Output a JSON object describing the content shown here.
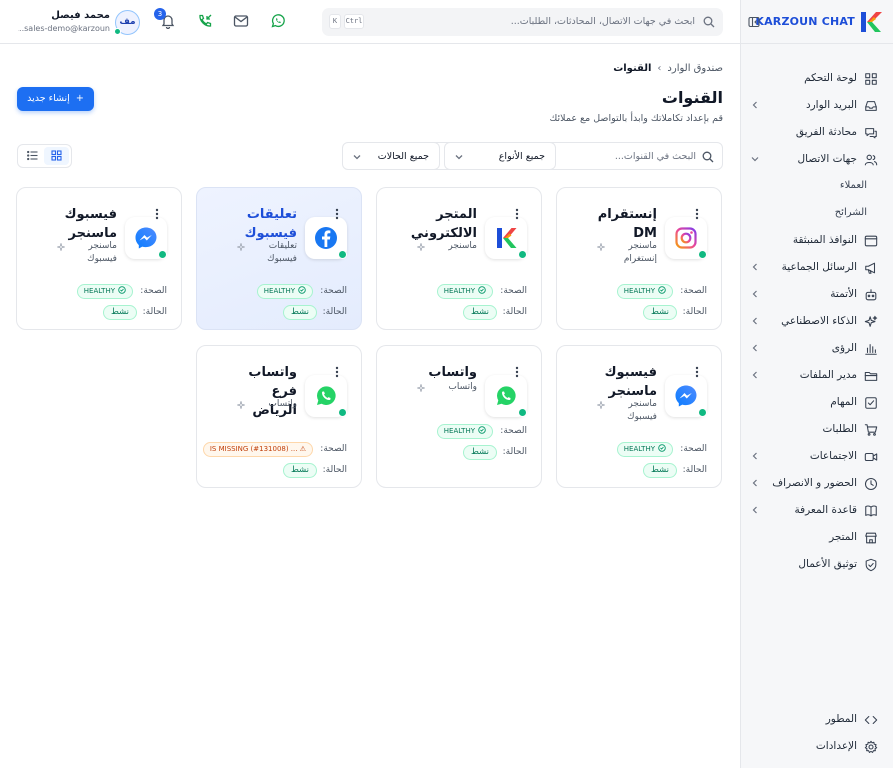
{
  "brand": {
    "name": "KARZOUN CHAT",
    "accent": "#1d4ed8"
  },
  "sidebar": {
    "items": [
      {
        "label": "لوحة التحكم",
        "icon": "dashboard-icon",
        "chevron": false,
        "sub": false
      },
      {
        "label": "البريد الوارد",
        "icon": "inbox-icon",
        "chevron": true,
        "sub": false
      },
      {
        "label": "محادثة الفريق",
        "icon": "chat-icon",
        "chevron": false,
        "sub": false
      },
      {
        "label": "جهات الاتصال",
        "icon": "users-icon",
        "chevron": true,
        "expanded": true,
        "sub": false
      },
      {
        "label": "العملاء",
        "icon": "",
        "chevron": false,
        "sub": true
      },
      {
        "label": "الشرائح",
        "icon": "",
        "chevron": false,
        "sub": true
      },
      {
        "label": "النوافذ المنبثقة",
        "icon": "window-icon",
        "chevron": false,
        "sub": false
      },
      {
        "label": "الرسائل الجماعية",
        "icon": "megaphone-icon",
        "chevron": true,
        "sub": false
      },
      {
        "label": "الأتمتة",
        "icon": "bot-icon",
        "chevron": true,
        "sub": false
      },
      {
        "label": "الذكاء الاصطناعي",
        "icon": "sparkles-icon",
        "chevron": true,
        "sub": false
      },
      {
        "label": "الرؤى",
        "icon": "chart-icon",
        "chevron": true,
        "sub": false
      },
      {
        "label": "مدير الملفات",
        "icon": "folder-icon",
        "chevron": true,
        "sub": false
      },
      {
        "label": "المهام",
        "icon": "task-icon",
        "chevron": false,
        "sub": false
      },
      {
        "label": "الطلبات",
        "icon": "cart-icon",
        "chevron": false,
        "sub": false
      },
      {
        "label": "الاجتماعات",
        "icon": "video-icon",
        "chevron": true,
        "sub": false
      },
      {
        "label": "الحضور و الانصراف",
        "icon": "clock-icon",
        "chevron": true,
        "sub": false
      },
      {
        "label": "قاعدة المعرفة",
        "icon": "book-icon",
        "chevron": true,
        "sub": false
      },
      {
        "label": "المتجر",
        "icon": "store-icon",
        "chevron": false,
        "sub": false
      },
      {
        "label": "توثيق الأعمال",
        "icon": "shield-icon",
        "chevron": false,
        "sub": false
      }
    ],
    "bottom": [
      {
        "label": "المطور",
        "icon": "code-icon"
      },
      {
        "label": "الإعدادات",
        "icon": "settings-icon"
      }
    ]
  },
  "topbar": {
    "search_placeholder": "ابحث في جهات الاتصال، المحادثات، الطلبات...",
    "kbd_ctrl": "Ctrl",
    "kbd_k": "K",
    "notif_count": "3",
    "user": {
      "initials": "مف",
      "name": "محمد فيصل",
      "email": "sales-demo@karzoun..."
    }
  },
  "breadcrumb": {
    "parent": "صندوق الوارد",
    "separator": "›",
    "current": "القنوات"
  },
  "page": {
    "title": "القنوات",
    "subtitle": "قم بإعداد تكاملاتك وابدأ بالتواصل مع عملائك",
    "create_label": "إنشاء جديد"
  },
  "filters": {
    "search_placeholder": "البحث في القنوات...",
    "type_value": "جميع الأنواع",
    "status_value": "جميع الحالات"
  },
  "labels": {
    "health": "الصحة:",
    "status": "الحالة:"
  },
  "cards": [
    {
      "title": "إنستقرام DM",
      "type": "ماسنجر إنستغرام",
      "icon": "instagram-icon",
      "health": "HEALTHY",
      "health_kind": "ok",
      "status": "نشط",
      "selected": false
    },
    {
      "title": "المتجر الالكتروني",
      "type": "ماسنجر",
      "icon": "karzoun-store-icon",
      "health": "HEALTHY",
      "health_kind": "ok",
      "status": "نشط",
      "selected": false
    },
    {
      "title": "تعليقات فيسبوك",
      "type": "تعليقات فيسبوك",
      "icon": "facebook-icon",
      "health": "HEALTHY",
      "health_kind": "ok",
      "status": "نشط",
      "selected": true
    },
    {
      "title": "فيسبوك ماسنجر",
      "type": "ماسنجر فيسبوك",
      "icon": "messenger-icon",
      "health": "HEALTHY",
      "health_kind": "ok",
      "status": "نشط",
      "selected": false
    },
    {
      "title": "فيسبوك ماسنجر",
      "type": "ماسنجر فيسبوك",
      "icon": "messenger-icon",
      "health": "HEALTHY",
      "health_kind": "ok",
      "status": "نشط",
      "selected": false
    },
    {
      "title": "واتساب",
      "type": "واتساب",
      "icon": "whatsapp-icon",
      "health": "HEALTHY",
      "health_kind": "ok",
      "status": "نشط",
      "selected": false
    },
    {
      "title": "واتساب فرع الرياض",
      "type": "واتساب",
      "icon": "whatsapp-icon",
      "health": "IS MISSING (#131008) ...",
      "health_kind": "warn",
      "status": "نشط",
      "selected": false
    }
  ]
}
